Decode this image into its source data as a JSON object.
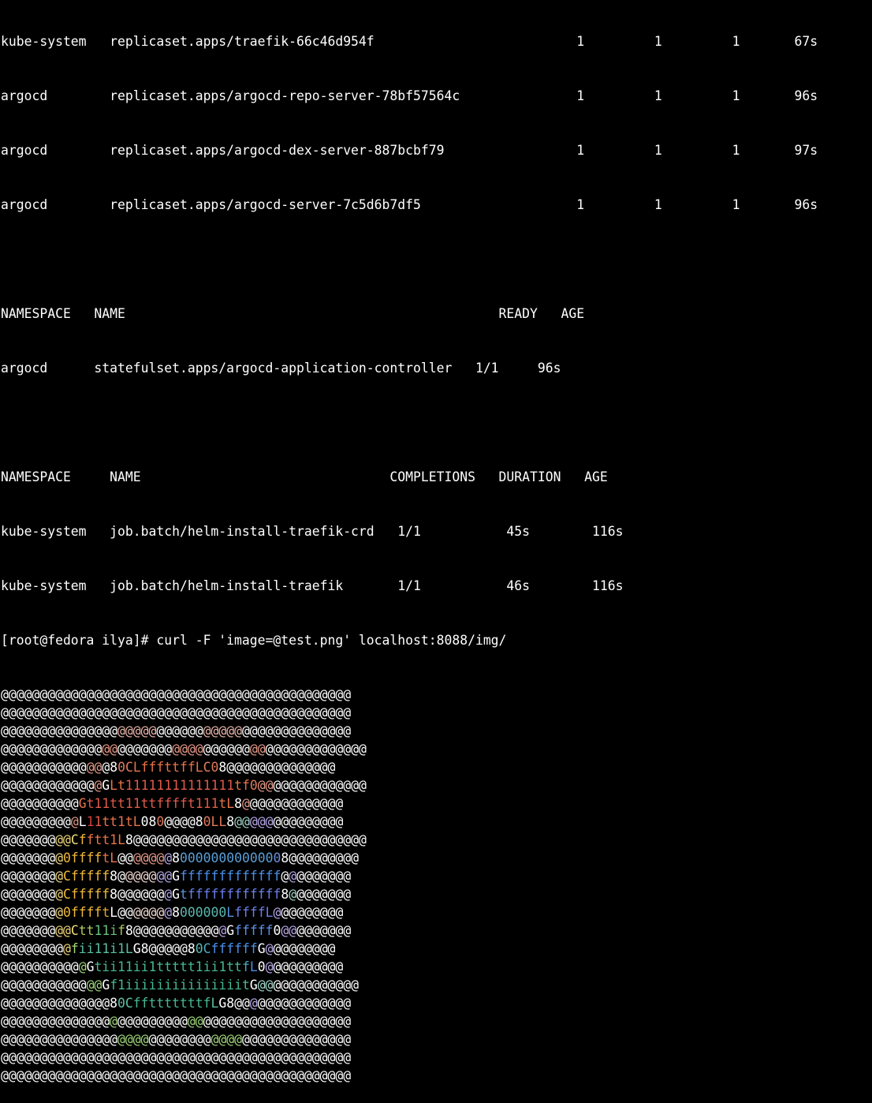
{
  "terminal": {
    "lines": [
      "kube-system   replicaset.apps/traefik-66c46d954f                          1         1         1       67s",
      "argocd        replicaset.apps/argocd-repo-server-78bf57564c               1         1         1       96s",
      "argocd        replicaset.apps/argocd-dex-server-887bcbf79                 1         1         1       97s",
      "argocd        replicaset.apps/argocd-server-7c5d6b7df5                    1         1         1       96s",
      "",
      "NAMESPACE   NAME                                                READY   AGE",
      "argocd      statefulset.apps/argocd-application-controller   1/1     96s",
      "",
      "NAMESPACE     NAME                                COMPLETIONS   DURATION   AGE",
      "kube-system   job.batch/helm-install-traefik-crd   1/1           45s        116s",
      "kube-system   job.batch/helm-install-traefik       1/1           46s        116s",
      "[root@fedora ilya]# curl -F 'image=@test.png' localhost:8088/img/"
    ],
    "ascii_art": [
      [
        [
          "@@@@@@@@@@@@@@@@@@@@@@@@@@@@@@@@@@@@@@@@@@@@@",
          "#ffffff"
        ]
      ],
      [
        [
          "@@@@@@@@@@@@@@@@@@@@@@@@@@@@@@@@@@@@@@@@@@@@@",
          "#ffffff"
        ]
      ],
      [
        [
          "@@@@@@@@@@@@@@@",
          "#ffffff"
        ],
        [
          "@@@@@",
          "#e8b4a8"
        ],
        [
          "@@@@@@",
          "#ffffff"
        ],
        [
          "@@@@@",
          "#e8b4a8"
        ],
        [
          "@@@@@@@@@@@@@@",
          "#ffffff"
        ]
      ],
      [
        [
          "@@@@@@@@@@@@@",
          "#ffffff"
        ],
        [
          "@@",
          "#e89a88"
        ],
        [
          "@@@@@@@",
          "#ffffff"
        ],
        [
          "@@@@",
          "#e89a88"
        ],
        [
          "@@@@@@",
          "#ffffff"
        ],
        [
          "@@",
          "#e89a88"
        ],
        [
          "@@@@@@@@@@@@@",
          "#ffffff"
        ]
      ],
      [
        [
          "@@@@@@@@@@@",
          "#ffffff"
        ],
        [
          "@@",
          "#e89a88"
        ],
        [
          "@",
          "#ffffff"
        ],
        [
          "8",
          "#ffffff"
        ],
        [
          "0",
          "#e07a5a"
        ],
        [
          "C",
          "#e07a5a"
        ],
        [
          "Lfffttff",
          "#e8734a"
        ],
        [
          "L",
          "#e8734a"
        ],
        [
          "C",
          "#e07a5a"
        ],
        [
          "0",
          "#e07a5a"
        ],
        [
          "8",
          "#ffffff"
        ],
        [
          "@@@@@@@@@@@@@@",
          "#ffffff"
        ]
      ],
      [
        [
          "@@@@@@@@@@@@",
          "#ffffff"
        ],
        [
          "@",
          "#e89a88"
        ],
        [
          "G",
          "#ffffff"
        ],
        [
          "Lt",
          "#e8734a"
        ],
        [
          "11111111111111",
          "#e05a4a"
        ],
        [
          "t",
          "#e8734a"
        ],
        [
          "f",
          "#e8734a"
        ],
        [
          "0",
          "#e07a5a"
        ],
        [
          "@@",
          "#e89a88"
        ],
        [
          "@@@@@@@@@@@@",
          "#ffffff"
        ]
      ],
      [
        [
          "@@@@@@@@@@",
          "#ffffff"
        ],
        [
          "G",
          "#e8734a"
        ],
        [
          "t11tt11ttffff",
          "#e05a4a"
        ],
        [
          "t",
          "#e05a4a"
        ],
        [
          "111",
          "#e05a4a"
        ],
        [
          "t",
          "#e8734a"
        ],
        [
          "L",
          "#e8734a"
        ],
        [
          "8",
          "#ffffff"
        ],
        [
          "@",
          "#e89a88"
        ],
        [
          "@@@@@@@@@@@@",
          "#ffffff"
        ]
      ],
      [
        [
          "@@@@@@@@@",
          "#ffffff"
        ],
        [
          "@",
          "#e89a88"
        ],
        [
          "L",
          "#ffffff"
        ],
        [
          "1",
          "#d04040"
        ],
        [
          "1",
          "#e05a4a"
        ],
        [
          "tt1t",
          "#e8734a"
        ],
        [
          "L",
          "#e8734a"
        ],
        [
          "0",
          "#ffffff"
        ],
        [
          "8",
          "#ffffff"
        ],
        [
          "0",
          "#e07a5a"
        ],
        [
          "@@@@",
          "#ffffff"
        ],
        [
          "8",
          "#ffffff"
        ],
        [
          "0",
          "#e07a5a"
        ],
        [
          "LL",
          "#e07a5a"
        ],
        [
          "8",
          "#ffffff"
        ],
        [
          "@@",
          "#9fd6c8"
        ],
        [
          "@@@",
          "#b8a8e8"
        ],
        [
          "@@@@@@@@@",
          "#ffffff"
        ]
      ],
      [
        [
          "@@@@@@@",
          "#ffffff"
        ],
        [
          "@@",
          "#f0d878"
        ],
        [
          "C",
          "#f0d878"
        ],
        [
          "f",
          "#f0b838"
        ],
        [
          "ftt1",
          "#e8734a"
        ],
        [
          "L",
          "#e8734a"
        ],
        [
          "8",
          "#ffffff"
        ],
        [
          "@@@@@@@@@@@@@@@@@@@@@@@@@@@@@@",
          "#ffffff"
        ]
      ],
      [
        [
          "@@@@@@@",
          "#ffffff"
        ],
        [
          "@",
          "#f0d878"
        ],
        [
          "0",
          "#f0b838"
        ],
        [
          "ffff",
          "#f0b838"
        ],
        [
          "t",
          "#e8734a"
        ],
        [
          "L",
          "#e8734a"
        ],
        [
          "@@",
          "#ffffff"
        ],
        [
          "@@@@",
          "#e89a88"
        ],
        [
          "@",
          "#b8a8e8"
        ],
        [
          "8",
          "#ffffff"
        ],
        [
          "000000000000",
          "#5a9fd8"
        ],
        [
          "0",
          "#6a8fd8"
        ],
        [
          "8",
          "#ffffff"
        ],
        [
          "@@@@@@@@@",
          "#ffffff"
        ]
      ],
      [
        [
          "@@@@@@@",
          "#ffffff"
        ],
        [
          "@",
          "#f0d878"
        ],
        [
          "C",
          "#f0b838"
        ],
        [
          "fffff",
          "#f0b838"
        ],
        [
          "8",
          "#ffffff"
        ],
        [
          "@",
          "#ffffff"
        ],
        [
          "@@@@",
          "#f0d8d0"
        ],
        [
          "@@",
          "#b8a8e8"
        ],
        [
          "G",
          "#ffffff"
        ],
        [
          "fffffffffffff",
          "#4a8fe8"
        ],
        [
          "@",
          "#ffffff"
        ],
        [
          "@",
          "#b8a8e8"
        ],
        [
          "@@@@@@@",
          "#ffffff"
        ]
      ],
      [
        [
          "@@@@@@@",
          "#ffffff"
        ],
        [
          "@",
          "#f0d878"
        ],
        [
          "C",
          "#f0b838"
        ],
        [
          "fffff",
          "#f0b838"
        ],
        [
          "8",
          "#ffffff"
        ],
        [
          "@@@@@@",
          "#ffffff"
        ],
        [
          "@",
          "#b8a8e8"
        ],
        [
          "G",
          "#ffffff"
        ],
        [
          "t",
          "#5a8fd8"
        ],
        [
          "ffffffffffff",
          "#6a7fe8"
        ],
        [
          "8",
          "#ffffff"
        ],
        [
          "@",
          "#9fd6c8"
        ],
        [
          "@@@@@@@",
          "#ffffff"
        ]
      ],
      [
        [
          "@@@@@@@",
          "#ffffff"
        ],
        [
          "@",
          "#f0d878"
        ],
        [
          "0",
          "#f0b838"
        ],
        [
          "ffff",
          "#f0b838"
        ],
        [
          "t",
          "#e0a838"
        ],
        [
          "L",
          "#ffffff"
        ],
        [
          "@@",
          "#ffffff"
        ],
        [
          "@@@@",
          "#f0d8d0"
        ],
        [
          "@",
          "#b8a8e8"
        ],
        [
          "8",
          "#ffffff"
        ],
        [
          "000000",
          "#5ab8b0"
        ],
        [
          "L",
          "#5a8fd8"
        ],
        [
          "ffff",
          "#6a7fe8"
        ],
        [
          "L",
          "#6a7fe8"
        ],
        [
          "@",
          "#b8a8e8"
        ],
        [
          "@@@@@@@@",
          "#ffffff"
        ]
      ],
      [
        [
          "@@@@@@@",
          "#ffffff"
        ],
        [
          "@@",
          "#f0d878"
        ],
        [
          "C",
          "#f0d878"
        ],
        [
          "tt",
          "#a8c858"
        ],
        [
          "11",
          "#68c080"
        ],
        [
          "i",
          "#68c080"
        ],
        [
          "f",
          "#a8c858"
        ],
        [
          "8",
          "#ffffff"
        ],
        [
          "@@@@@@@@@@@",
          "#ffffff"
        ],
        [
          "@",
          "#b8a8e8"
        ],
        [
          "G",
          "#ffffff"
        ],
        [
          "fffff",
          "#5a8fe8"
        ],
        [
          "0",
          "#ffffff"
        ],
        [
          "@@",
          "#b8a8e8"
        ],
        [
          "@@@@@@@",
          "#ffffff"
        ]
      ],
      [
        [
          "@@@@@@@@",
          "#ffffff"
        ],
        [
          "@",
          "#f0d878"
        ],
        [
          "f",
          "#9fd678"
        ],
        [
          "ii11i1",
          "#58c0a0"
        ],
        [
          "L",
          "#58c0a0"
        ],
        [
          "G",
          "#ffffff"
        ],
        [
          "8",
          "#ffffff"
        ],
        [
          "@@@@@",
          "#ffffff"
        ],
        [
          "8",
          "#ffffff"
        ],
        [
          "0",
          "#5ab8b0"
        ],
        [
          "C",
          "#4aa8c0"
        ],
        [
          "ffffff",
          "#4a8fe8"
        ],
        [
          "G",
          "#ffffff"
        ],
        [
          "@",
          "#b8a8e8"
        ],
        [
          "@@@@@@@@",
          "#ffffff"
        ]
      ],
      [
        [
          "@@@@@@@@@@",
          "#ffffff"
        ],
        [
          "@",
          "#9fd678"
        ],
        [
          "G",
          "#ffffff"
        ],
        [
          "tii11ii1ttttt1ii1tt",
          "#48b890"
        ],
        [
          "f",
          "#4aa8c0"
        ],
        [
          "L",
          "#4a8fe8"
        ],
        [
          "0",
          "#ffffff"
        ],
        [
          "@",
          "#b8a8e8"
        ],
        [
          "@@@@@@@@@",
          "#ffffff"
        ]
      ],
      [
        [
          "@@@@@@@@@@@",
          "#ffffff"
        ],
        [
          "@@",
          "#9fd678"
        ],
        [
          "G",
          "#ffffff"
        ],
        [
          "f1iiiiiiiiiiiiiiit",
          "#48b890"
        ],
        [
          "G",
          "#ffffff"
        ],
        [
          "@@",
          "#9fd6c8"
        ],
        [
          "@@@@@@@@@@@",
          "#ffffff"
        ]
      ],
      [
        [
          "@@@@@@@@@@@@@@",
          "#ffffff"
        ],
        [
          "8",
          "#ffffff"
        ],
        [
          "0",
          "#58c0a0"
        ],
        [
          "C",
          "#58c0a0"
        ],
        [
          "fftttttttf",
          "#48b890"
        ],
        [
          "L",
          "#58c0a0"
        ],
        [
          "G",
          "#ffffff"
        ],
        [
          "8",
          "#ffffff"
        ],
        [
          "@@",
          "#ffffff"
        ],
        [
          "@",
          "#b8a8e8"
        ],
        [
          "@@@@@@@@@@@@",
          "#ffffff"
        ]
      ],
      [
        [
          "@@@@@@@@@@@@@@",
          "#ffffff"
        ],
        [
          "@",
          "#9fd678"
        ],
        [
          "@@@@@@@@@",
          "#ffffff"
        ],
        [
          "@@",
          "#9fd678"
        ],
        [
          "@@@@@@@@@@@@@@@@@@@",
          "#ffffff"
        ]
      ],
      [
        [
          "@@@@@@@@@@@@@@@",
          "#ffffff"
        ],
        [
          "@@@@",
          "#9fd678"
        ],
        [
          "@@@@@@@@",
          "#ffffff"
        ],
        [
          "@@@@",
          "#9fd678"
        ],
        [
          "@@@@@@@@@@@@@@",
          "#ffffff"
        ]
      ],
      [
        [
          "@@@@@@@@@@@@@@@@@@@@@@@@@@@@@@@@@@@@@@@@@@@@@",
          "#ffffff"
        ]
      ],
      [
        [
          "@@@@@@@@@@@@@@@@@@@@@@@@@@@@@@@@@@@@@@@@@@@@@",
          "#ffffff"
        ]
      ]
    ]
  }
}
